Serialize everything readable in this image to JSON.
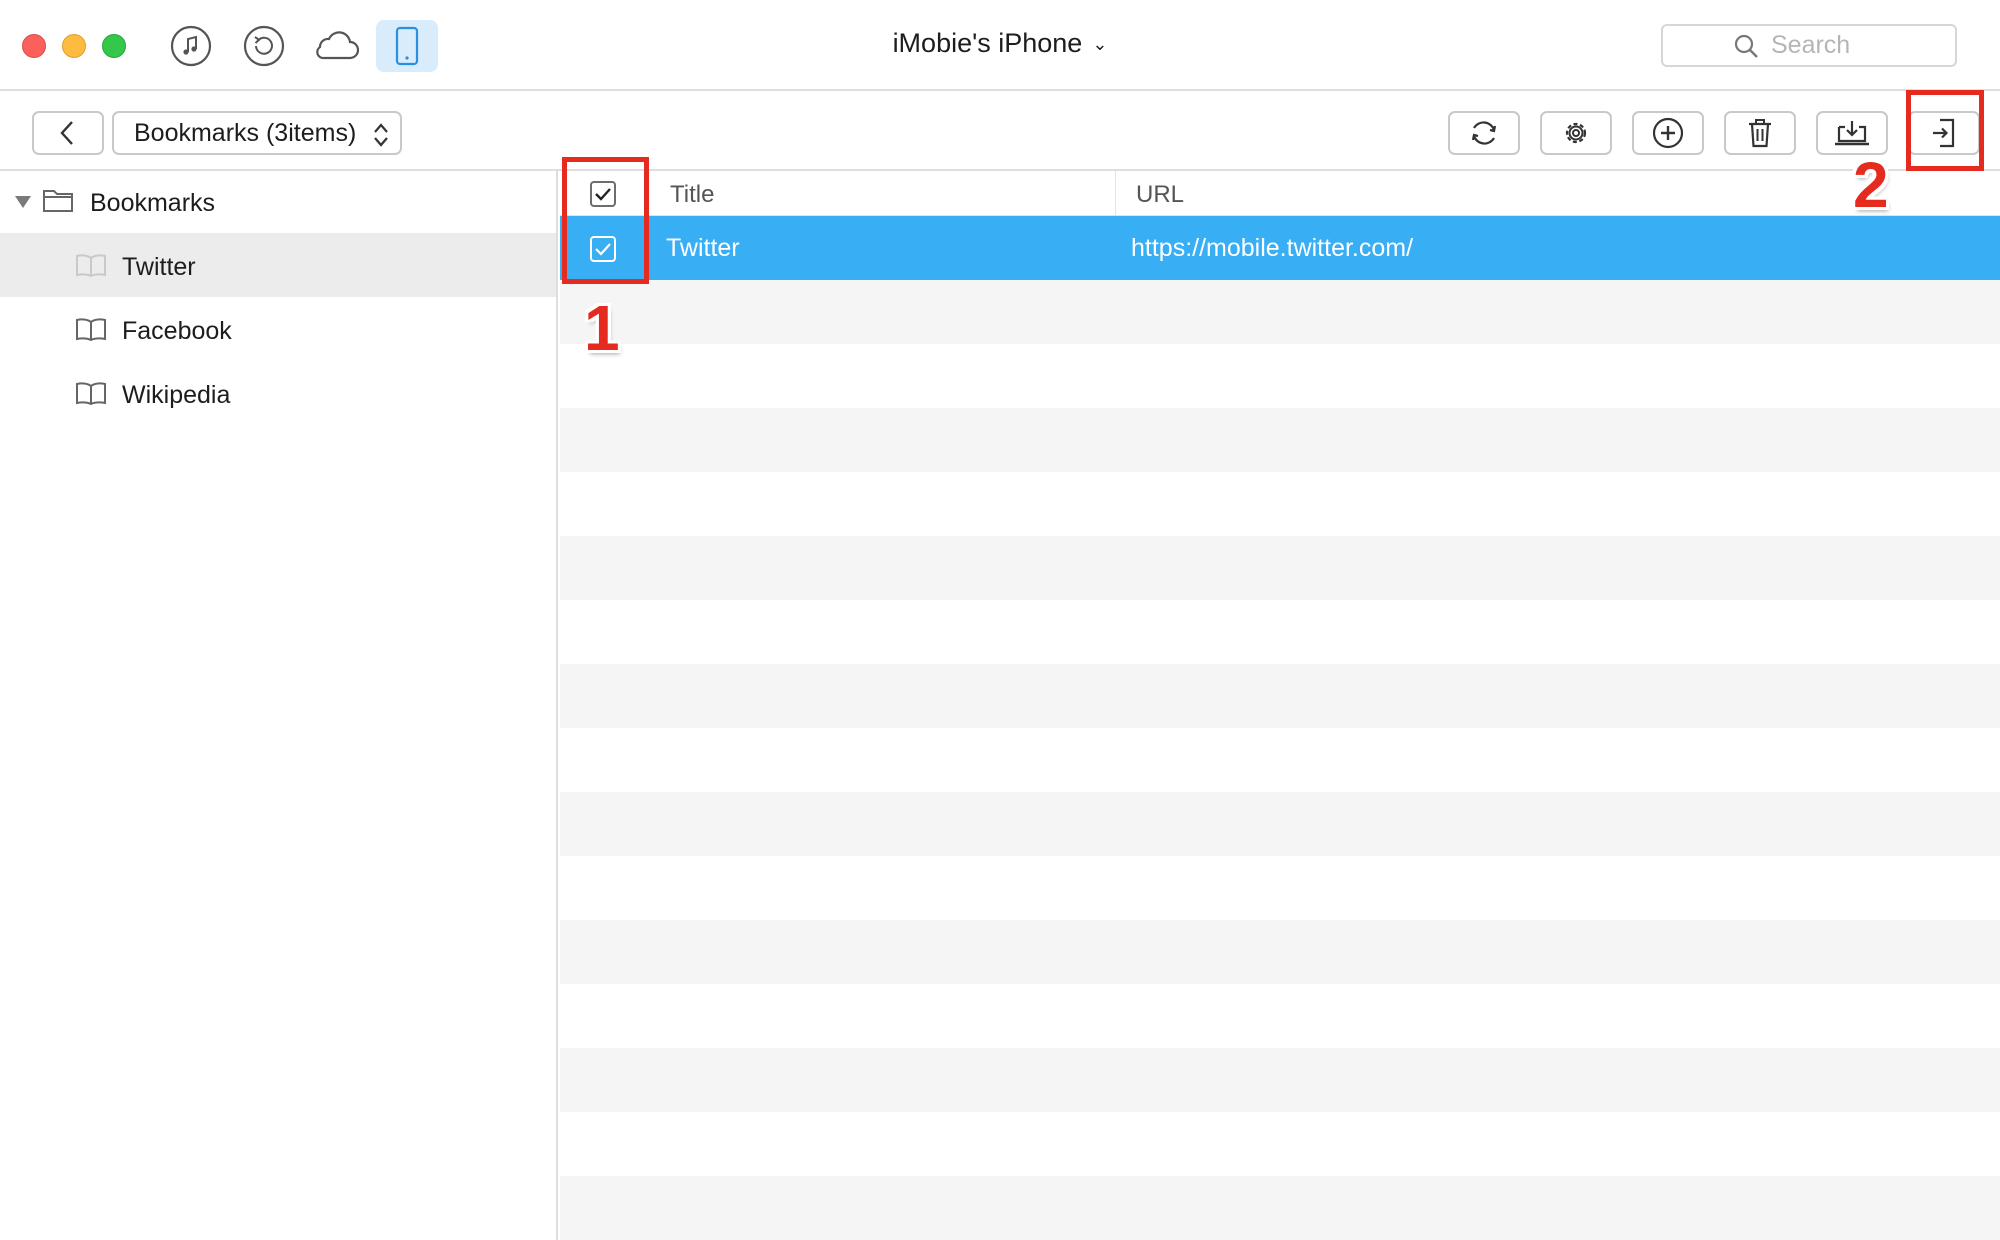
{
  "window": {
    "traffic_lights": [
      "close",
      "minimize",
      "zoom"
    ],
    "toolbar_icons": [
      {
        "name": "music-icon",
        "active": false
      },
      {
        "name": "backup-restore-icon",
        "active": false
      },
      {
        "name": "icloud-icon",
        "active": false
      },
      {
        "name": "iphone-icon",
        "active": true
      }
    ],
    "device_name": "iMobie's iPhone",
    "search_placeholder": "Search"
  },
  "toolbar": {
    "breadcrumb": "Bookmarks (3items)",
    "actions": [
      "refresh-icon",
      "settings-gear-icon",
      "add-icon",
      "delete-trash-icon",
      "export-to-computer-icon",
      "export-to-device-icon"
    ]
  },
  "sidebar": {
    "root_label": "Bookmarks",
    "items": [
      {
        "label": "Twitter",
        "selected": true
      },
      {
        "label": "Facebook",
        "selected": false
      },
      {
        "label": "Wikipedia",
        "selected": false
      }
    ]
  },
  "table": {
    "columns": {
      "title": "Title",
      "url": "URL"
    },
    "header_checked": true,
    "rows": [
      {
        "title": "Twitter",
        "url": "https://mobile.twitter.com/",
        "checked": true,
        "selected": true
      }
    ]
  },
  "annotations": [
    "1",
    "2"
  ],
  "colors": {
    "selection_blue": "#38aef5",
    "annotation_red": "#e52b1f",
    "active_tab_bg": "#d9ecfb"
  }
}
